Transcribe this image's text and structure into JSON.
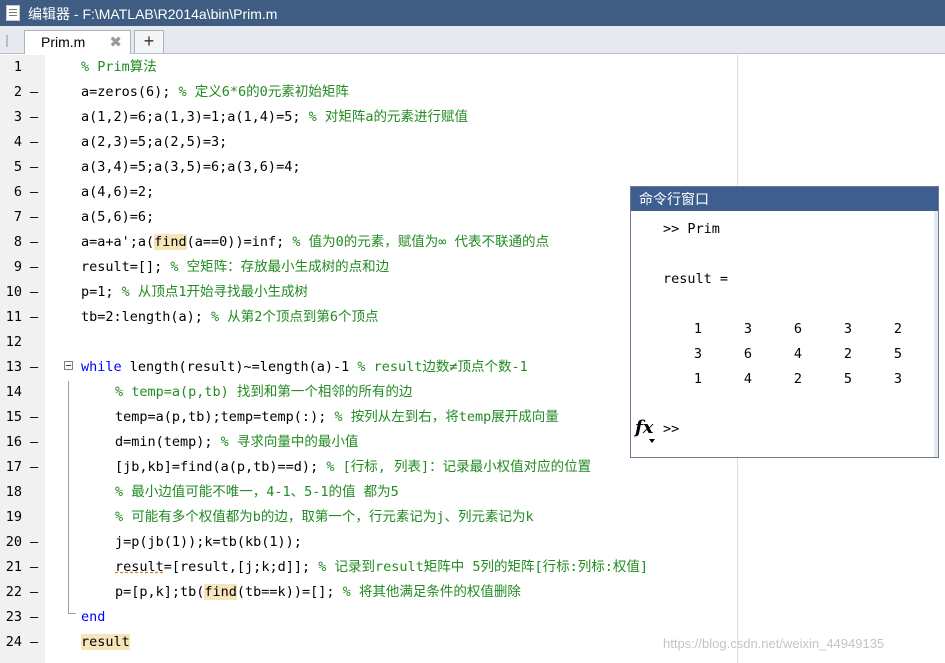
{
  "window": {
    "title": "编辑器 - F:\\MATLAB\\R2014a\\bin\\Prim.m",
    "icon": "editor-document-icon"
  },
  "tabs": {
    "items": [
      {
        "label": "Prim.m",
        "close_glyph": "✖"
      }
    ],
    "add_glyph": "+"
  },
  "editor": {
    "lines": [
      {
        "num": "1",
        "dash": "",
        "segments": [
          {
            "t": "% Prim算法",
            "c": "cm"
          }
        ]
      },
      {
        "num": "2",
        "dash": "—",
        "segments": [
          {
            "t": "a=zeros(6); ",
            "c": ""
          },
          {
            "t": "% 定义6*6的0元素初始矩阵",
            "c": "cm"
          }
        ]
      },
      {
        "num": "3",
        "dash": "—",
        "segments": [
          {
            "t": "a(1,2)=6;a(1,3)=1;a(1,4)=5; ",
            "c": ""
          },
          {
            "t": "% 对矩阵a的元素进行赋值",
            "c": "cm"
          }
        ]
      },
      {
        "num": "4",
        "dash": "—",
        "segments": [
          {
            "t": "a(2,3)=5;a(2,5)=3;",
            "c": ""
          }
        ]
      },
      {
        "num": "5",
        "dash": "—",
        "segments": [
          {
            "t": "a(3,4)=5;a(3,5)=6;a(3,6)=4;",
            "c": ""
          }
        ]
      },
      {
        "num": "6",
        "dash": "—",
        "segments": [
          {
            "t": "a(4,6)=2;",
            "c": ""
          }
        ]
      },
      {
        "num": "7",
        "dash": "—",
        "segments": [
          {
            "t": "a(5,6)=6;",
            "c": ""
          }
        ]
      },
      {
        "num": "8",
        "dash": "—",
        "segments": [
          {
            "t": "a=a+a';a(",
            "c": ""
          },
          {
            "t": "find",
            "c": "hl"
          },
          {
            "t": "(a==0))=inf; ",
            "c": ""
          },
          {
            "t": "% 值为0的元素，赋值为∞ 代表不联通的点",
            "c": "cm"
          }
        ]
      },
      {
        "num": "9",
        "dash": "—",
        "segments": [
          {
            "t": "result=[]; ",
            "c": ""
          },
          {
            "t": "% 空矩阵：存放最小生成树的点和边",
            "c": "cm"
          }
        ]
      },
      {
        "num": "10",
        "dash": "—",
        "segments": [
          {
            "t": "p=1; ",
            "c": ""
          },
          {
            "t": "% 从顶点1开始寻找最小生成树",
            "c": "cm"
          }
        ]
      },
      {
        "num": "11",
        "dash": "—",
        "segments": [
          {
            "t": "tb=2:length(a); ",
            "c": ""
          },
          {
            "t": "% 从第2个顶点到第6个顶点",
            "c": "cm"
          }
        ]
      },
      {
        "num": "12",
        "dash": "",
        "segments": []
      },
      {
        "num": "13",
        "dash": "—",
        "fold": true,
        "segments": [
          {
            "t": "while",
            "c": "kw"
          },
          {
            "t": " length(result)~=length(a)-1 ",
            "c": ""
          },
          {
            "t": "% result边数≠顶点个数-1",
            "c": "cm"
          }
        ]
      },
      {
        "num": "14",
        "dash": "",
        "indent": true,
        "segments": [
          {
            "t": "% temp=a(p,tb) 找到和第一个相邻的所有的边",
            "c": "cm"
          }
        ]
      },
      {
        "num": "15",
        "dash": "—",
        "indent": true,
        "segments": [
          {
            "t": "temp=a(p,tb);temp=temp(:); ",
            "c": ""
          },
          {
            "t": "% 按列从左到右，将temp展开成向量",
            "c": "cm"
          }
        ]
      },
      {
        "num": "16",
        "dash": "—",
        "indent": true,
        "segments": [
          {
            "t": "d=min(temp); ",
            "c": ""
          },
          {
            "t": "% 寻求向量中的最小值",
            "c": "cm"
          }
        ]
      },
      {
        "num": "17",
        "dash": "—",
        "indent": true,
        "segments": [
          {
            "t": "[jb,kb]=find(a(p,tb)==d); ",
            "c": ""
          },
          {
            "t": "% [行标, 列表]：记录最小权值对应的位置",
            "c": "cm"
          }
        ]
      },
      {
        "num": "18",
        "dash": "",
        "indent": true,
        "segments": [
          {
            "t": "% 最小边值可能不唯一，4-1、5-1的值 都为5",
            "c": "cm"
          }
        ]
      },
      {
        "num": "19",
        "dash": "",
        "indent": true,
        "segments": [
          {
            "t": "% 可能有多个权值都为b的边，取第一个，行元素记为j、列元素记为k",
            "c": "cm"
          }
        ]
      },
      {
        "num": "20",
        "dash": "—",
        "indent": true,
        "segments": [
          {
            "t": "j=p(jb(1));k=tb(kb(1));",
            "c": ""
          }
        ]
      },
      {
        "num": "21",
        "dash": "—",
        "indent": true,
        "segments": [
          {
            "t": "result",
            "c": "ul"
          },
          {
            "t": "=[result,[j;k;d]]; ",
            "c": ""
          },
          {
            "t": "% 记录到result矩阵中 5列的矩阵[行标:列标:权值]",
            "c": "cm"
          }
        ]
      },
      {
        "num": "22",
        "dash": "—",
        "indent": true,
        "segments": [
          {
            "t": "p=[p,k];tb(",
            "c": ""
          },
          {
            "t": "find",
            "c": "hl"
          },
          {
            "t": "(tb==k))=[]; ",
            "c": ""
          },
          {
            "t": "% 将其他满足条件的权值删除",
            "c": "cm"
          }
        ]
      },
      {
        "num": "23",
        "dash": "—",
        "segments": [
          {
            "t": "end",
            "c": "kw"
          }
        ]
      },
      {
        "num": "24",
        "dash": "—",
        "segments": [
          {
            "t": "result",
            "c": "hl"
          }
        ]
      }
    ]
  },
  "command_window": {
    "title": "命令行窗口",
    "command": ">> Prim",
    "output_label": "result =",
    "matrix": [
      [
        "1",
        "3",
        "6",
        "3",
        "2"
      ],
      [
        "3",
        "6",
        "4",
        "2",
        "5"
      ],
      [
        "1",
        "4",
        "2",
        "5",
        "3"
      ]
    ],
    "fx_label": "fx",
    "prompt": ">>"
  },
  "watermark": "https://blog.csdn.net/weixin_44949135"
}
